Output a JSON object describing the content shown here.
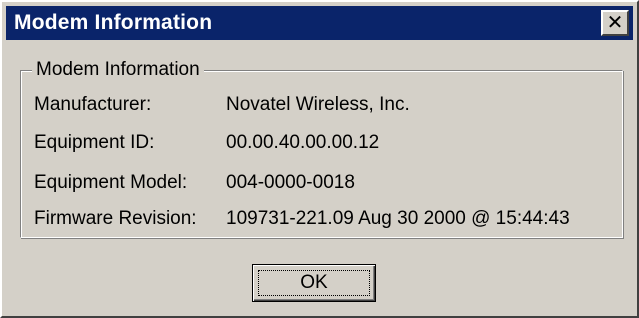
{
  "window": {
    "title": "Modem Information",
    "close_glyph": "✕"
  },
  "group": {
    "legend": "Modem Information",
    "rows": [
      {
        "label": "Manufacturer:",
        "value": "Novatel Wireless, Inc."
      },
      {
        "label": "Equipment ID:",
        "value": "00.00.40.00.00.12"
      },
      {
        "label": "Equipment Model:",
        "value": "004-0000-0018"
      },
      {
        "label": "Firmware Revision:",
        "value": "109731-221.09 Aug 30 2000 @ 15:44:43"
      }
    ]
  },
  "buttons": {
    "ok_label": "OK"
  },
  "colors": {
    "titlebar": "#0a246a",
    "face": "#d4d0c8"
  },
  "icons": {
    "close": "close-icon"
  }
}
